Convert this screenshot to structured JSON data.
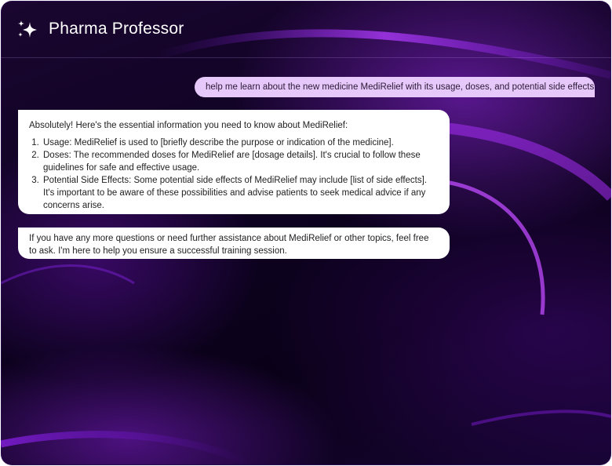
{
  "app": {
    "title": "Pharma Professor",
    "logo_icon": "sparkles-icon"
  },
  "messages": {
    "user_1": "help me learn about the new medicine MediRelief with its usage, doses, and potential side effects",
    "bot_1": {
      "intro": "Absolutely! Here's the essential information you need to know about MediRelief:",
      "items": [
        "Usage: MediRelief is used to [briefly describe the purpose or indication of the medicine].",
        "Doses: The recommended doses for MediRelief are [dosage details]. It's crucial to follow these guidelines for safe and effective usage.",
        "Potential Side Effects: Some potential side effects of MediRelief may include [list of side effects]. It's important to be aware of these possibilities and advise patients to seek medical advice if any concerns arise."
      ]
    },
    "bot_2": "If you have any more questions or need further assistance about MediRelief or other topics, feel free to ask. I'm here to help you ensure a successful training session."
  },
  "colors": {
    "accent": "#9b2cf0",
    "user_bubble": "#e7c8fb",
    "bot_bubble": "#ffffff",
    "background": "#0d0220"
  }
}
